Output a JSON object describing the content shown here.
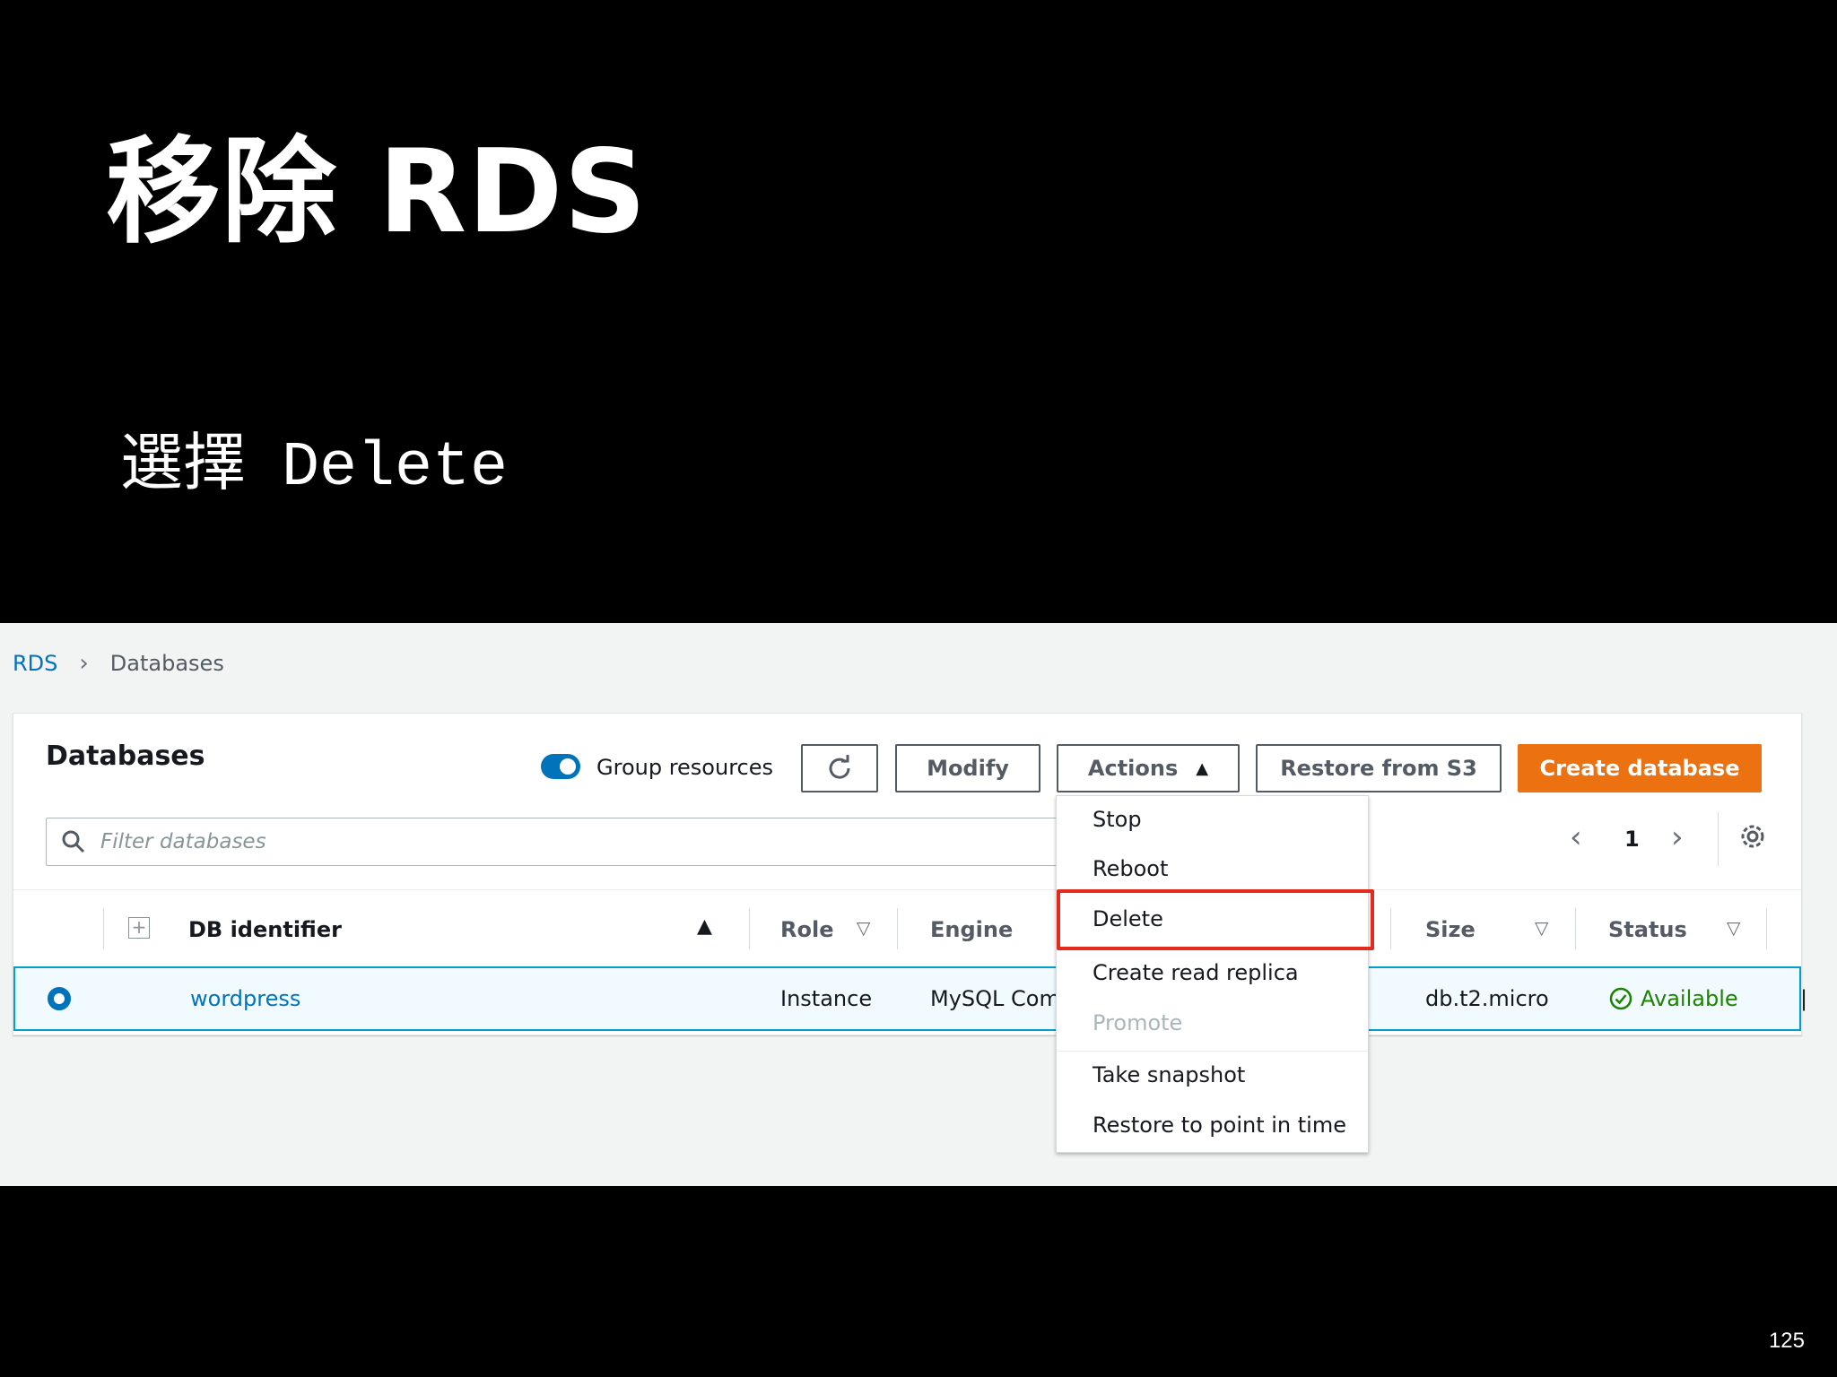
{
  "slide": {
    "title": "移除 RDS",
    "subtitle_cjk": "選擇",
    "subtitle_mono": "Delete",
    "page_number": "125"
  },
  "breadcrumb": {
    "root": "RDS",
    "current": "Databases"
  },
  "panel": {
    "title": "Databases",
    "group_resources_label": "Group resources",
    "group_resources_on": true
  },
  "toolbar": {
    "refresh_icon": "refresh-icon",
    "modify_label": "Modify",
    "actions_label": "Actions",
    "restore_label": "Restore from S3",
    "create_label": "Create database"
  },
  "search": {
    "placeholder": "Filter databases",
    "value": ""
  },
  "pagination": {
    "prev": "‹",
    "page": "1",
    "next": "›"
  },
  "table": {
    "columns": {
      "id": "DB identifier",
      "role": "Role",
      "engine": "Engine",
      "size": "Size",
      "status": "Status"
    },
    "rows": [
      {
        "id": "wordpress",
        "role": "Instance",
        "engine": "MySQL Community",
        "size": "db.t2.micro",
        "status": "Available",
        "selected": true
      }
    ]
  },
  "actions_menu": {
    "items": [
      {
        "label": "Stop",
        "disabled": false
      },
      {
        "label": "Reboot",
        "disabled": false
      },
      {
        "label": "Delete",
        "disabled": false,
        "highlighted": true
      },
      {
        "label": "Create read replica",
        "disabled": false
      },
      {
        "label": "Promote",
        "disabled": true
      },
      {
        "label": "Take snapshot",
        "disabled": false
      },
      {
        "label": "Restore to point in time",
        "disabled": false
      }
    ]
  },
  "colors": {
    "link": "#0073bb",
    "primary_button": "#ec7211",
    "status_available": "#1d8102",
    "highlight_box": "#e22b1d"
  }
}
